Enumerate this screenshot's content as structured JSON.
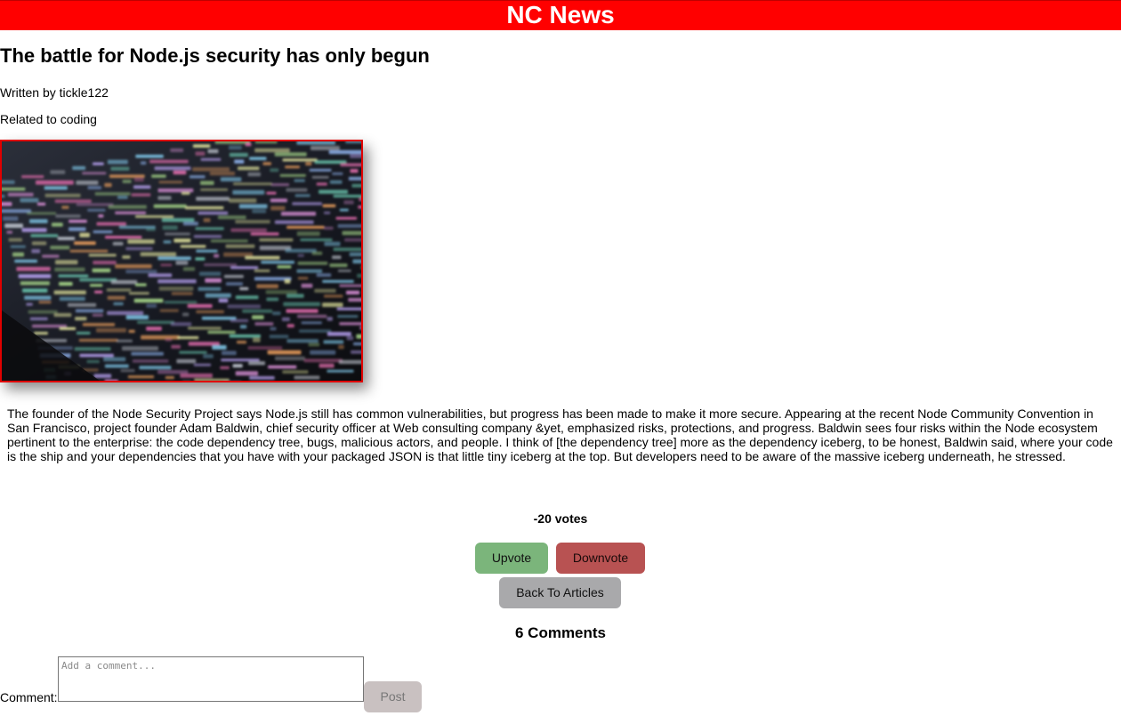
{
  "header": {
    "title": "NC News"
  },
  "article": {
    "title": "The battle for Node.js security has only begun",
    "author_line": "Written by tickle122",
    "topic_line": "Related to coding",
    "body": "The founder of the Node Security Project says Node.js still has common vulnerabilities, but progress has been made to make it more secure. Appearing at the recent Node Community Convention in San Francisco, project founder Adam Baldwin, chief security officer at Web consulting company &yet, emphasized risks, protections, and progress. Baldwin sees four risks within the Node ecosystem pertinent to the enterprise: the code dependency tree, bugs, malicious actors, and people. I think of [the dependency tree] more as the dependency iceberg, to be honest, Baldwin said, where your code is the ship and your dependencies that you have with your packaged JSON is that little tiny iceberg at the top. But developers need to be aware of the massive iceberg underneath, he stressed."
  },
  "votes": {
    "label": "-20 votes",
    "upvote": "Upvote",
    "downvote": "Downvote"
  },
  "nav": {
    "back": "Back To Articles"
  },
  "comments": {
    "count_label": "6 Comments",
    "field_label": "Comment:",
    "placeholder": "Add a comment...",
    "post": "Post"
  },
  "colors": {
    "header": "#ff0000",
    "upvote": "#7bb57b",
    "downvote": "#b85252",
    "back": "#a9a9ab",
    "post": "#c9c1c1"
  }
}
